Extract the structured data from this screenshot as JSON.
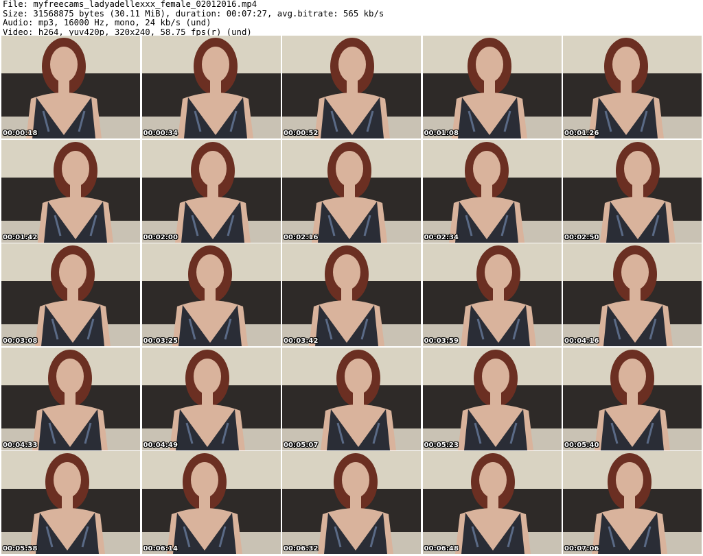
{
  "header": {
    "line1": "File: myfreecams_ladyadellexxx_female_02012016.mp4",
    "line2": "Size: 31568875 bytes (30.11 MiB), duration: 00:07:27, avg.bitrate: 565 kb/s",
    "line3": "Audio: mp3, 16000 Hz, mono, 24 kb/s (und)",
    "line4": "Video: h264, yuv420p, 320x240, 58.75 fps(r) (und)"
  },
  "thumbnails": [
    {
      "timestamp": "00:00:18"
    },
    {
      "timestamp": "00:00:34"
    },
    {
      "timestamp": "00:00:52"
    },
    {
      "timestamp": "00:01:08"
    },
    {
      "timestamp": "00:01:26"
    },
    {
      "timestamp": "00:01:42"
    },
    {
      "timestamp": "00:02:00"
    },
    {
      "timestamp": "00:02:16"
    },
    {
      "timestamp": "00:02:34"
    },
    {
      "timestamp": "00:02:50"
    },
    {
      "timestamp": "00:03:08"
    },
    {
      "timestamp": "00:03:25"
    },
    {
      "timestamp": "00:03:42"
    },
    {
      "timestamp": "00:03:59"
    },
    {
      "timestamp": "00:04:16"
    },
    {
      "timestamp": "00:04:33"
    },
    {
      "timestamp": "00:04:49"
    },
    {
      "timestamp": "00:05:07"
    },
    {
      "timestamp": "00:05:23"
    },
    {
      "timestamp": "00:05:40"
    },
    {
      "timestamp": "00:05:58"
    },
    {
      "timestamp": "00:06:14"
    },
    {
      "timestamp": "00:06:32"
    },
    {
      "timestamp": "00:06:48"
    },
    {
      "timestamp": "00:07:06"
    }
  ],
  "colors": {
    "wall": "#d9d3c2",
    "headboard": "#2e2a28",
    "bedding": "#c9c2b4",
    "hair": "#6b2f22",
    "skin": "#d9b39c",
    "dress": "#2a2d36",
    "dress_highlight": "#5a6a86"
  }
}
